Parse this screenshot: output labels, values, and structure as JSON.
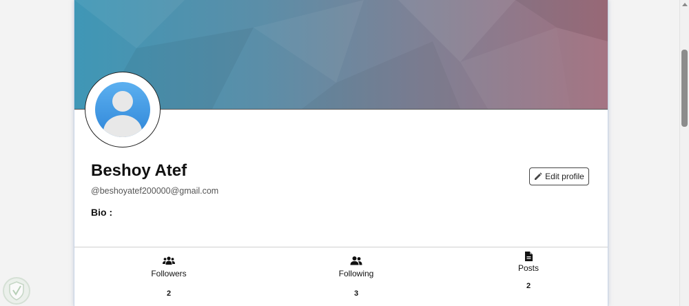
{
  "profile": {
    "name": "Beshoy Atef",
    "email": "@beshoyatef200000@gmail.com",
    "bio_label": "Bio :",
    "edit_label": "Edit profile"
  },
  "stats": {
    "followers": {
      "label": "Followers",
      "count": "2",
      "icon": "users-group-icon"
    },
    "following": {
      "label": "Following",
      "count": "3",
      "icon": "user-friends-icon"
    },
    "posts": {
      "label": "Posts",
      "count": "2",
      "icon": "file-icon"
    }
  },
  "colors": {
    "cover_start": "#3f97b6",
    "cover_end": "#a26f7e",
    "avatar_blue": "#3a93de"
  }
}
